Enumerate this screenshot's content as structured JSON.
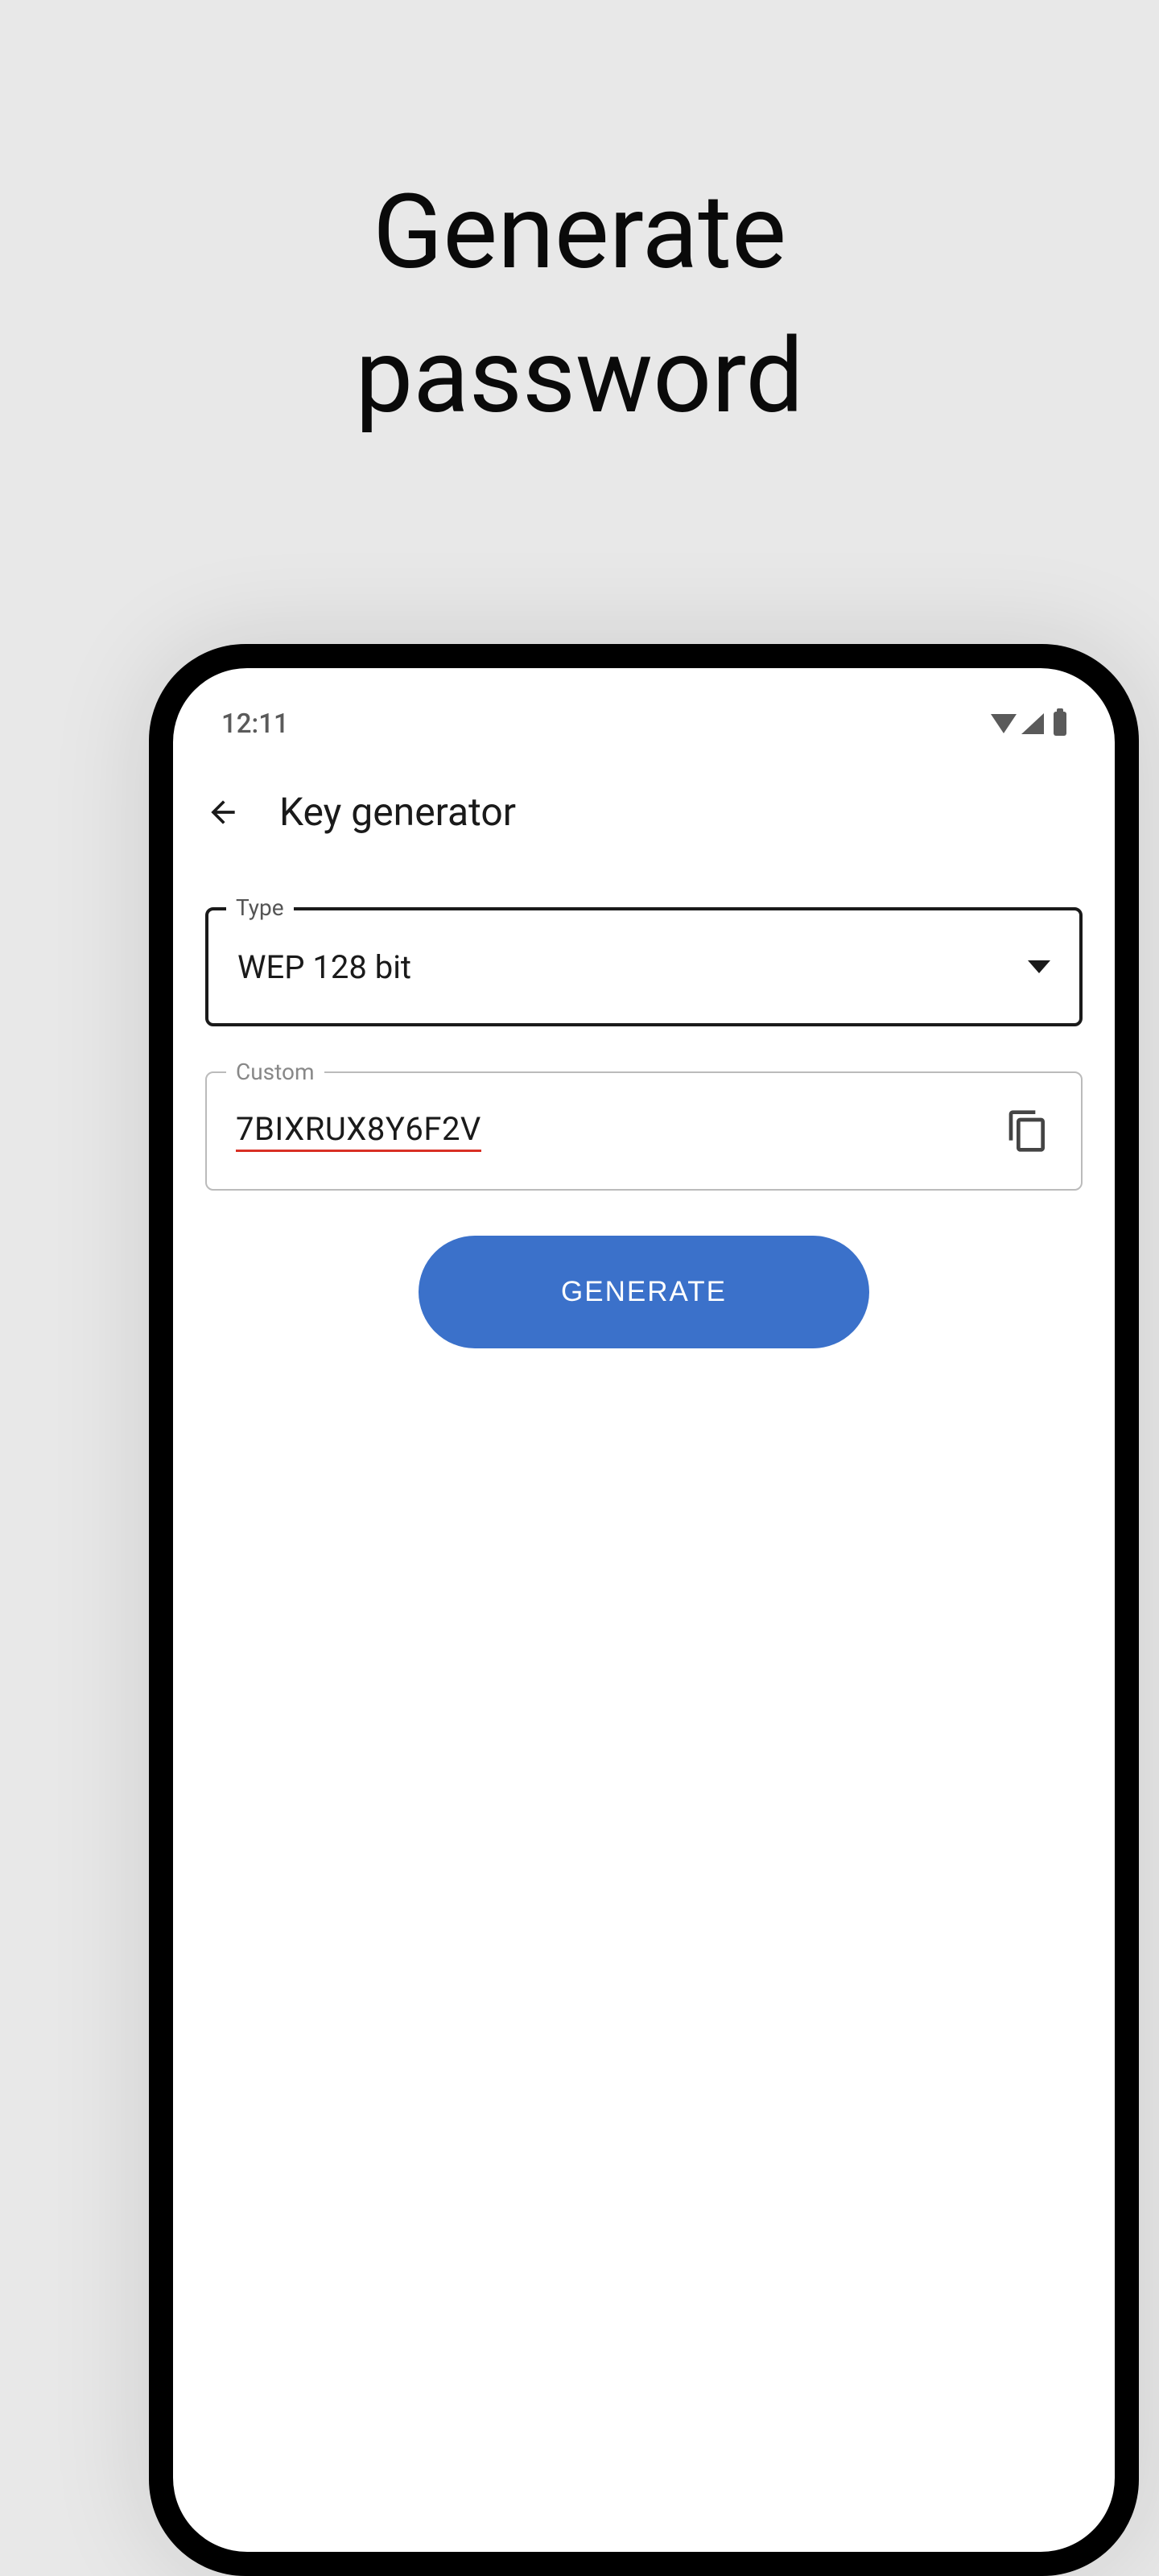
{
  "promo": {
    "title_line1": "Generate",
    "title_line2": "password"
  },
  "status": {
    "time": "12:11"
  },
  "app_bar": {
    "title": "Key generator"
  },
  "type_field": {
    "label": "Type",
    "value": "WEP 128 bit"
  },
  "custom_field": {
    "label": "Custom",
    "value": "7BIXRUX8Y6F2V"
  },
  "buttons": {
    "generate": "GENERATE"
  },
  "colors": {
    "accent": "#3B71CA",
    "spellcheck_underline": "#d93025"
  }
}
